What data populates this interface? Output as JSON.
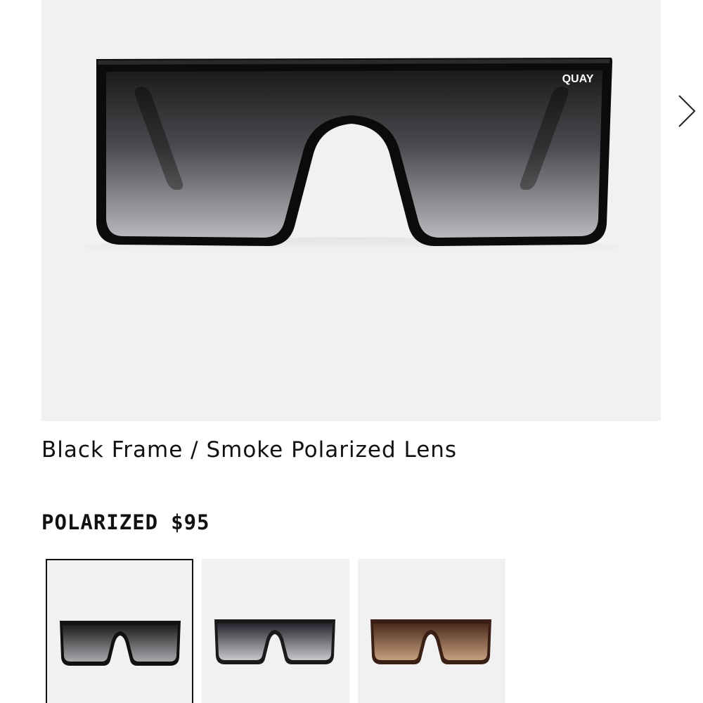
{
  "product": {
    "brand_logo": "QUAY",
    "variant_name": "Black Frame / Smoke Polarized Lens",
    "lens_type": "POLARIZED",
    "price": "$95"
  },
  "gallery": {
    "next_icon": "chevron-right-icon"
  },
  "swatches": [
    {
      "label": "Black Frame / Smoke Polarized Lens",
      "selected": true,
      "frame_color": "#111111",
      "lens_top": "#1c1c1e",
      "lens_bottom": "#a9a9ad"
    },
    {
      "label": "Black Frame / Smoke Fade Lens",
      "selected": false,
      "frame_color": "#1a1a1a",
      "lens_top": "#2a2630",
      "lens_bottom": "#c9c6cc"
    },
    {
      "label": "Tortoise Frame / Brown Lens",
      "selected": false,
      "frame_color": "#3a1f14",
      "lens_top": "#4a2a1c",
      "lens_bottom": "#c7a07e"
    }
  ],
  "colors": {
    "background": "#ffffff",
    "image_background": "#f1f1f1",
    "text": "#111111"
  }
}
